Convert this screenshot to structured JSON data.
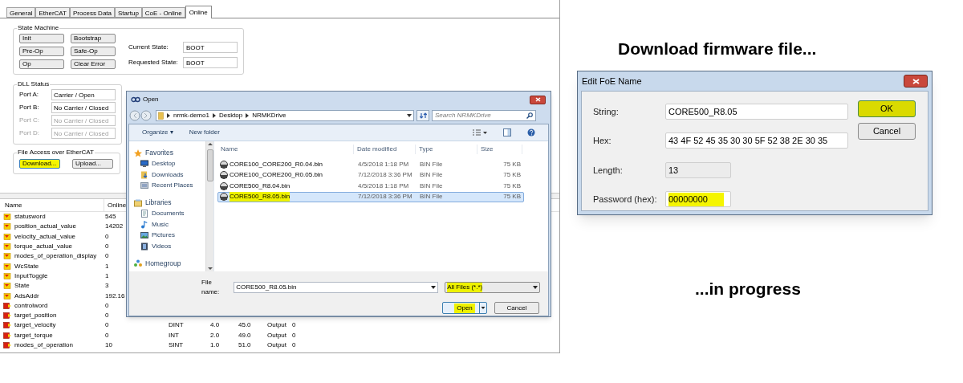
{
  "main_window": {
    "tabs": [
      {
        "label": "General",
        "selected": false
      },
      {
        "label": "EtherCAT",
        "selected": false
      },
      {
        "label": "Process Data",
        "selected": false
      },
      {
        "label": "Startup",
        "selected": false
      },
      {
        "label": "CoE - Online",
        "selected": false
      },
      {
        "label": "Online",
        "selected": true
      }
    ],
    "state_machine": {
      "title": "State Machine",
      "buttons": [
        "Init",
        "Bootstrap",
        "Pre-Op",
        "Safe-Op",
        "Op",
        "Clear Error"
      ],
      "current_state_label": "Current State:",
      "current_state": "BOOT",
      "requested_state_label": "Requested State:",
      "requested_state": "BOOT"
    },
    "dll_status": {
      "title": "DLL Status",
      "ports": [
        {
          "label": "Port A:",
          "value": "Carrier / Open",
          "disabled": false
        },
        {
          "label": "Port B:",
          "value": "No Carrier / Closed",
          "disabled": false
        },
        {
          "label": "Port C:",
          "value": "No Carrier / Closed",
          "disabled": true
        },
        {
          "label": "Port D:",
          "value": "No Carrier / Closed",
          "disabled": true
        }
      ]
    },
    "file_access": {
      "title": "File Access over EtherCAT",
      "buttons": [
        {
          "label": "Download...",
          "highlighted": true
        },
        {
          "label": "Upload...",
          "highlighted": false
        }
      ]
    },
    "variables": {
      "columns": [
        "Name",
        "Online"
      ],
      "rows": [
        {
          "kind": "input",
          "name": "statusword",
          "online": "545"
        },
        {
          "kind": "input",
          "name": "position_actual_value",
          "online": "14202"
        },
        {
          "kind": "input",
          "name": "velocity_actual_value",
          "online": "0"
        },
        {
          "kind": "input",
          "name": "torque_actual_value",
          "online": "0"
        },
        {
          "kind": "input",
          "name": "modes_of_operation_display",
          "online": "0"
        },
        {
          "kind": "input",
          "name": "WcState",
          "online": "1"
        },
        {
          "kind": "input",
          "name": "InputToggle",
          "online": "1"
        },
        {
          "kind": "input",
          "name": "State",
          "online": "3"
        },
        {
          "kind": "input",
          "name": "AdsAddr",
          "online": "192.16"
        },
        {
          "kind": "output",
          "name": "controlword",
          "online": "0"
        },
        {
          "kind": "output",
          "name": "target_position",
          "online": "0"
        },
        {
          "kind": "output",
          "name": "target_velocity",
          "online": "0",
          "cells": [
            "DINT",
            "4.0",
            "45.0",
            "Output",
            "0"
          ]
        },
        {
          "kind": "output",
          "name": "target_torque",
          "online": "0",
          "cells": [
            "INT",
            "2.0",
            "49.0",
            "Output",
            "0"
          ]
        },
        {
          "kind": "output",
          "name": "modes_of_operation",
          "online": "10",
          "cells": [
            "SINT",
            "1.0",
            "51.0",
            "Output",
            "0"
          ]
        }
      ]
    }
  },
  "caption_top": "Download firmware file...",
  "open_dialog": {
    "title": "Open",
    "breadcrumb": [
      "nrmk-demo1",
      "Desktop",
      "NRMKDrive"
    ],
    "search_placeholder": "Search NRMKDrive",
    "toolbar": [
      "Organize ▾",
      "New folder"
    ],
    "nav": [
      {
        "kind": "heading",
        "label": "Favorites"
      },
      {
        "kind": "item",
        "label": "Desktop"
      },
      {
        "kind": "item",
        "label": "Downloads"
      },
      {
        "kind": "item",
        "label": "Recent Places"
      },
      {
        "kind": "heading",
        "label": "Libraries"
      },
      {
        "kind": "item",
        "label": "Documents"
      },
      {
        "kind": "item",
        "label": "Music"
      },
      {
        "kind": "item",
        "label": "Pictures"
      },
      {
        "kind": "item",
        "label": "Videos"
      },
      {
        "kind": "heading",
        "label": "Homegroup"
      }
    ],
    "columns": [
      "Name",
      "Date modified",
      "Type",
      "Size"
    ],
    "files": [
      {
        "name": "CORE100_CORE200_R0.04.bin",
        "date_modified": "4/5/2018 1:18 PM",
        "type": "BIN File",
        "size": "75 KB",
        "selected": false,
        "highlighted": false
      },
      {
        "name": "CORE100_CORE200_R0.05.bin",
        "date_modified": "7/12/2018 3:36 PM",
        "type": "BIN File",
        "size": "75 KB",
        "selected": false,
        "highlighted": false
      },
      {
        "name": "CORE500_R8.04.bin",
        "date_modified": "4/5/2018 1:18 PM",
        "type": "BIN File",
        "size": "75 KB",
        "selected": false,
        "highlighted": false
      },
      {
        "name": "CORE500_R8.05.bin",
        "date_modified": "7/12/2018 3:36 PM",
        "type": "BIN File",
        "size": "75 KB",
        "selected": true,
        "highlighted": true
      }
    ],
    "file_name_label": "File name:",
    "file_name": "CORE500_R8.05.bin",
    "file_type": {
      "label": "All Files (*.*)",
      "highlighted": true
    },
    "buttons": [
      {
        "label": "Open",
        "highlighted": true
      },
      {
        "label": "Cancel",
        "highlighted": false
      }
    ]
  },
  "foe_dialog": {
    "title": "Edit FoE Name",
    "fields": [
      {
        "label": "String:",
        "value": "CORE500_R8.05",
        "disabled": false,
        "highlighted": false
      },
      {
        "label": "Hex:",
        "value": "43 4F 52 45 35 30 30 5F 52 38 2E 30 35",
        "disabled": false,
        "highlighted": false
      },
      {
        "label": "Length:",
        "value": "13",
        "disabled": true,
        "highlighted": false
      },
      {
        "label": "Password (hex):",
        "value": "00000000",
        "disabled": false,
        "highlighted": true
      }
    ],
    "buttons": [
      {
        "label": "OK",
        "highlighted": true
      },
      {
        "label": "Cancel",
        "highlighted": false
      }
    ]
  },
  "caption_bottom": "...in progress"
}
